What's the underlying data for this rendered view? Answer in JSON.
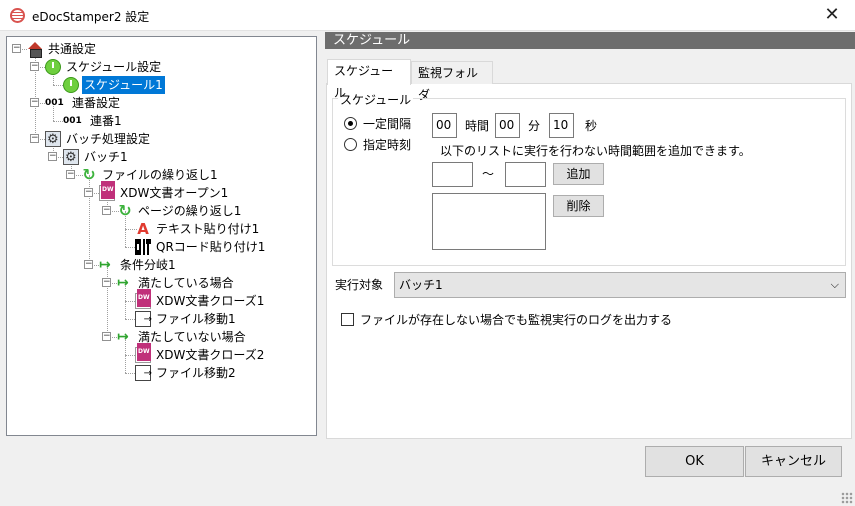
{
  "window": {
    "title": "eDocStamper2 設定",
    "close_label": "✕"
  },
  "tree": [
    {
      "label": "共通設定",
      "icon": "house-icon"
    },
    {
      "label": "スケジュール設定",
      "icon": "clock-icon"
    },
    {
      "label": "スケジュール1",
      "icon": "clock-icon",
      "selected": true
    },
    {
      "label": "連番設定",
      "icon": "number-icon",
      "icon_text": "001"
    },
    {
      "label": "連番1",
      "icon": "number-icon",
      "icon_text": "001"
    },
    {
      "label": "バッチ処理設定",
      "icon": "gear-icon"
    },
    {
      "label": "バッチ1",
      "icon": "gear-icon"
    },
    {
      "label": "ファイルの繰り返し1",
      "icon": "loop-icon"
    },
    {
      "label": "XDW文書オープン1",
      "icon": "xdw-document-icon"
    },
    {
      "label": "ページの繰り返し1",
      "icon": "loop-icon"
    },
    {
      "label": "テキスト貼り付け1",
      "icon": "text-a-icon"
    },
    {
      "label": "QRコード貼り付け1",
      "icon": "qr-code-icon"
    },
    {
      "label": "条件分岐1",
      "icon": "branch-icon"
    },
    {
      "label": "満たしている場合",
      "icon": "branch-icon"
    },
    {
      "label": "XDW文書クローズ1",
      "icon": "xdw-document-icon"
    },
    {
      "label": "ファイル移動1",
      "icon": "file-move-icon"
    },
    {
      "label": "満たしていない場合",
      "icon": "branch-icon"
    },
    {
      "label": "XDW文書クローズ2",
      "icon": "xdw-document-icon"
    },
    {
      "label": "ファイル移動2",
      "icon": "file-move-icon"
    }
  ],
  "panel": {
    "header": "スケジュール"
  },
  "tabs": [
    {
      "label": "スケジュール",
      "active": true
    },
    {
      "label": "監視フォルダ",
      "active": false
    }
  ],
  "schedule": {
    "group_title": "スケジュール",
    "radio_interval": "一定間隔",
    "radio_specified": "指定時刻",
    "hours_value": "00",
    "hours_label": "時間",
    "minutes_value": "00",
    "minutes_label": "分",
    "seconds_value": "10",
    "seconds_label": "秒",
    "exclude_hint": "以下のリストに実行を行わない時間範囲を追加できます。",
    "range_separator": "～",
    "range_from": "",
    "range_to": "",
    "add_label": "追加",
    "delete_label": "削除"
  },
  "target": {
    "label": "実行対象",
    "value": "バッチ1"
  },
  "log_option": {
    "label": "ファイルが存在しない場合でも監視実行のログを出力する",
    "checked": false
  },
  "footer": {
    "ok_label": "OK",
    "cancel_label": "キャンセル"
  }
}
